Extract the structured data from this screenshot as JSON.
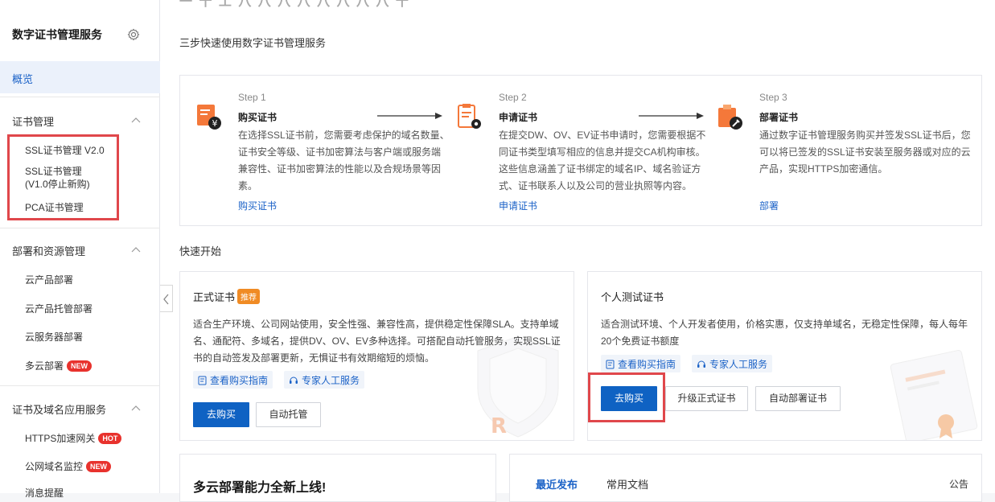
{
  "sidebar": {
    "title": "数字证书管理服务",
    "overview": "概览",
    "sections": [
      {
        "label": "证书管理",
        "items": [
          "SSL证书管理 V2.0",
          "SSL证书管理",
          "(V1.0停止新购)",
          "PCA证书管理"
        ]
      },
      {
        "label": "部署和资源管理",
        "items": [
          "云产品部署",
          "云产品托管部署",
          "云服务器部署",
          "多云部署"
        ]
      },
      {
        "label": "证书及域名应用服务",
        "items": [
          "HTTPS加速网关",
          "公网域名监控",
          "消息提醒"
        ]
      }
    ],
    "badges": {
      "new": "NEW",
      "hot": "HOT"
    }
  },
  "main": {
    "top_cut_text": "一 十 工 八 八 八 八 八 八 八 八 十",
    "steps_heading": "三步快速使用数字证书管理服务",
    "steps": [
      {
        "no": "Step 1",
        "title": "购买证书",
        "desc": [
          "在选择SSL证书前，您需要考虑保护的域名数量、",
          "证书安全等级、证书加密算法与客户端或服务端",
          "兼容性、证书加密算法的性能以及合规场景等因",
          "素。"
        ],
        "link": "购买证书"
      },
      {
        "no": "Step 2",
        "title": "申请证书",
        "desc": [
          "在提交DW、OV、EV证书申请时，您需要根据不",
          "同证书类型填写相应的信息并提交CA机构审核。",
          "这些信息涵盖了证书绑定的域名IP、域名验证方",
          "式、证书联系人以及公司的营业执照等内容。"
        ],
        "link": "申请证书"
      },
      {
        "no": "Step 3",
        "title": "部署证书",
        "desc": [
          "通过数字证书管理服务购买并签发SSL证书后，您",
          "可以将已签发的SSL证书安装至服务器或对应的云",
          "产品，实现HTTPS加密通信。"
        ],
        "link": "部署"
      }
    ],
    "quick_start": "快速开始",
    "cards": [
      {
        "title": "正式证书",
        "tag": "推荐",
        "desc": [
          "适合生产环境、公司网站使用，安全性强、兼容性高，提供稳定性保障SLA。支持单域",
          "名、通配符、多域名，提供DV、OV、EV多种选择。可搭配自动托管服务，实现SSL证",
          "书的自动签发及部署更新，无惧证书有效期缩短的烦恼。"
        ],
        "pills": [
          "查看购买指南",
          "专家人工服务"
        ],
        "buttons": [
          "去购买",
          "自动托管"
        ]
      },
      {
        "title": "个人测试证书",
        "desc": [
          "适合测试环境、个人开发者使用，价格实惠，仅支持单域名，无稳定性保障，每人每年",
          "20个免费证书额度"
        ],
        "pills": [
          "查看购买指南",
          "专家人工服务"
        ],
        "buttons": [
          "去购买",
          "升级正式证书",
          "自动部署证书"
        ]
      }
    ],
    "bottom_left_title": "多云部署能力全新上线!",
    "bottom_right": {
      "tabs": [
        "最近发布",
        "常用文档"
      ],
      "notice": "公告"
    }
  },
  "colors": {
    "accent": "#0f62c3",
    "link": "#1b62c7",
    "highlight": "#e0474b",
    "badge": "#e8322d",
    "tag": "#f08b24"
  }
}
